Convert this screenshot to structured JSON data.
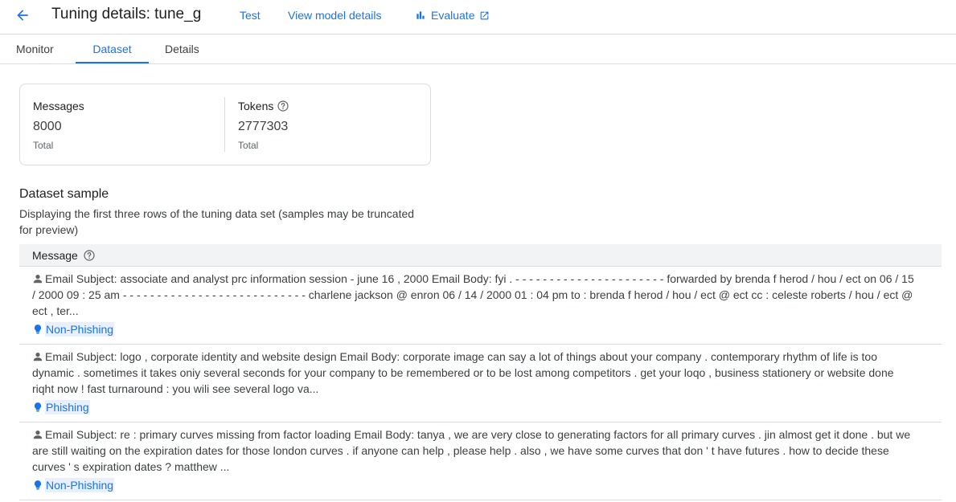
{
  "header": {
    "title": "Tuning details: tune_g",
    "actions": {
      "test": "Test",
      "view_model": "View model details",
      "evaluate": "Evaluate"
    }
  },
  "tabs": [
    {
      "label": "Monitor",
      "active": false
    },
    {
      "label": "Dataset",
      "active": true
    },
    {
      "label": "Details",
      "active": false
    }
  ],
  "stats": {
    "messages": {
      "label": "Messages",
      "value": "8000",
      "sub": "Total"
    },
    "tokens": {
      "label": "Tokens",
      "value": "2777303",
      "sub": "Total"
    }
  },
  "sample": {
    "title": "Dataset sample",
    "description": "Displaying the first three rows of the tuning data set (samples may be truncated for preview)",
    "column_header": "Message",
    "rows": [
      {
        "text": "Email Subject: associate and analyst prc information session - june 16 , 2000 Email Body: fyi . - - - - - - - - - - - - - - - - - - - - - - forwarded by brenda f herod / hou / ect on 06 / 15 / 2000 09 : 25 am - - - - - - - - - - - - - - - - - - - - - - - - - - - charlene jackson @ enron 06 / 14 / 2000 01 : 04 pm to : brenda f herod / hou / ect @ ect cc : celeste roberts / hou / ect @ ect , ter...",
        "label": "Non-Phishing"
      },
      {
        "text": "Email Subject: logo , corporate identity and website design Email Body: corporate image can say a lot of things about your company . contemporary rhythm of life is too dynamic . sometimes it takes oniy several seconds for your company to be remembered or to be lost among competitors . get your loqo , business stationery or website done riqht now ! fast turnaround : you wili see several logo va...",
        "label": "Phishing"
      },
      {
        "text": "Email Subject: re : primary curves missing from factor loading Email Body: tanya , we are very close to generating factors for all primary curves . jin almost get it done . but we are still waiting on the expiration dates for those london curves . if anyone can help , please help . also , we have some curves that don ' t have futures . how to decide these curves ' s expiration dates ? matthew ...",
        "label": "Non-Phishing"
      }
    ]
  },
  "colors": {
    "accent": "#1a73e8",
    "label_bg": "#e8f0fe",
    "border": "#dadce0",
    "header_bg": "#f1f3f4"
  },
  "icons": {
    "back": "arrow-back-icon",
    "evaluate": "bar-chart-icon",
    "external": "open-in-new-icon",
    "help": "help-circle-icon",
    "user": "person-icon",
    "label": "lightbulb-icon"
  }
}
